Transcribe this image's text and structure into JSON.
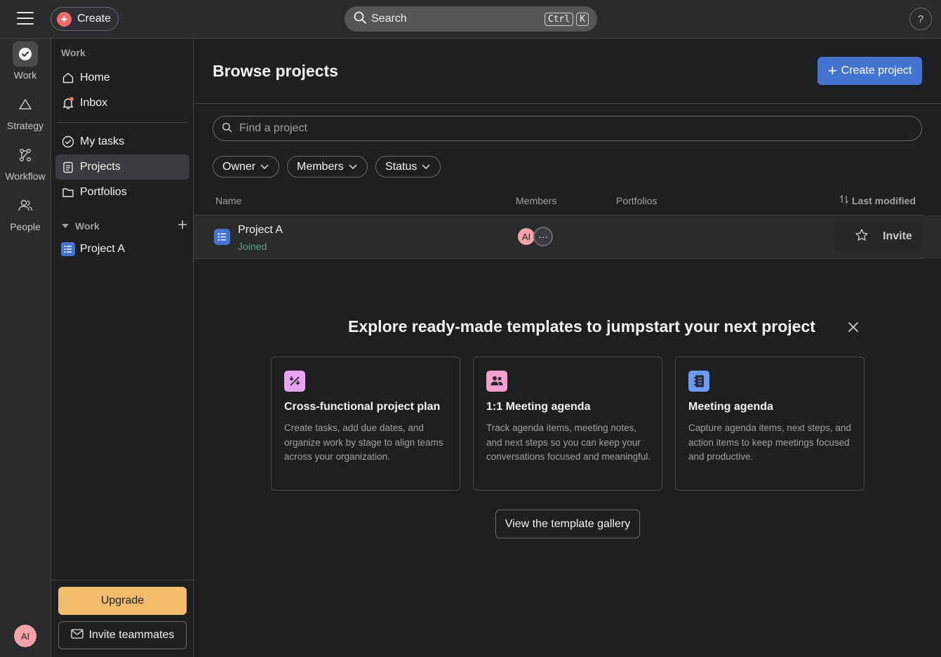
{
  "topbar": {
    "create_label": "Create",
    "search_label": "Search",
    "shortcut_keys": [
      "Ctrl",
      "K"
    ],
    "help_label": "?"
  },
  "rail": {
    "items": [
      {
        "label": "Work",
        "icon": "check-circle-icon"
      },
      {
        "label": "Strategy",
        "icon": "triangle-icon"
      },
      {
        "label": "Workflow",
        "icon": "workflow-icon"
      },
      {
        "label": "People",
        "icon": "people-icon"
      }
    ],
    "avatar_initials": "AI"
  },
  "sidebar": {
    "heading": "Work",
    "items": [
      {
        "label": "Home",
        "icon": "home-icon"
      },
      {
        "label": "Inbox",
        "icon": "bell-icon"
      },
      {
        "label": "My tasks",
        "icon": "check-circle-icon"
      },
      {
        "label": "Projects",
        "icon": "clipboard-icon"
      },
      {
        "label": "Portfolios",
        "icon": "folder-icon"
      }
    ],
    "section_label": "Work",
    "section_projects": [
      "Project A"
    ],
    "upgrade_label": "Upgrade",
    "invite_label": "Invite teammates"
  },
  "main": {
    "title": "Browse projects",
    "create_project_label": "Create project",
    "find_placeholder": "Find a project",
    "filters": [
      "Owner",
      "Members",
      "Status"
    ],
    "columns": {
      "name": "Name",
      "members": "Members",
      "portfolios": "Portfolios",
      "last_modified": "Last modified"
    },
    "rows": [
      {
        "name": "Project A",
        "status": "Joined",
        "member_initials": "AI",
        "more": "···",
        "action": "Invite"
      }
    ]
  },
  "templates": {
    "title": "Explore ready-made templates to jumpstart your next project",
    "cards": [
      {
        "title": "Cross-functional project plan",
        "description": "Create tasks, add due dates, and organize work by stage to align teams across your organization.",
        "icon": "percent-swap-icon",
        "color": "#e8a3f2"
      },
      {
        "title": "1:1 Meeting agenda",
        "description": "Track agenda items, meeting notes, and next steps so you can keep your conversations focused and meaningful.",
        "icon": "people-icon",
        "color": "#f59fcf"
      },
      {
        "title": "Meeting agenda",
        "description": "Capture agenda items, next steps, and action items to keep meetings focused and productive.",
        "icon": "notebook-icon",
        "color": "#6b9cf5"
      }
    ],
    "gallery_label": "View the template gallery"
  },
  "colors": {
    "accent": "#4573d2",
    "create_red": "#f06a6a",
    "upgrade": "#f1bd6c",
    "joined_green": "#5da283"
  }
}
